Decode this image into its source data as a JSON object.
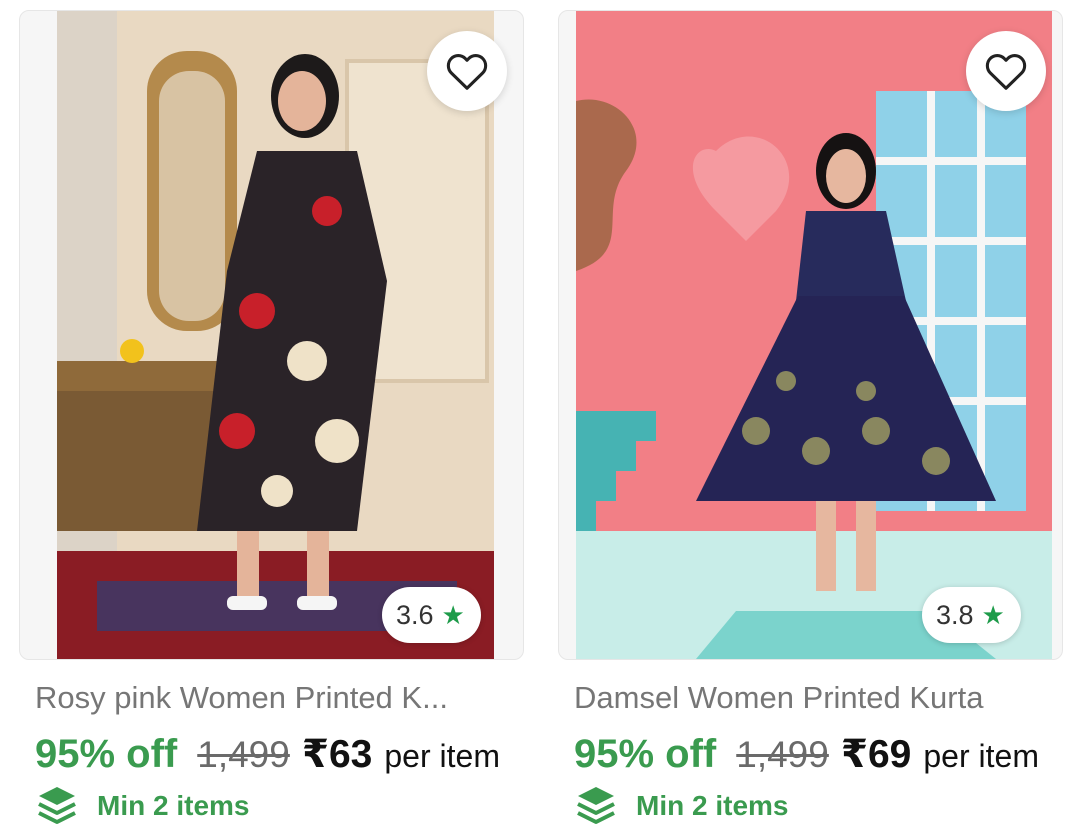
{
  "products": [
    {
      "title": "Rosy pink Women Printed K...",
      "rating": "3.6",
      "discount": "95% off",
      "mrp": "1,499",
      "price": "₹63",
      "unit": "per item",
      "min_order": "Min 2 items",
      "icons": {
        "wishlist": "heart-outline-icon",
        "rating": "star-icon",
        "min": "layers-icon"
      }
    },
    {
      "title": "Damsel Women Printed Kurta",
      "rating": "3.8",
      "discount": "95% off",
      "mrp": "1,499",
      "price": "₹69",
      "unit": "per item",
      "min_order": "Min 2 items",
      "icons": {
        "wishlist": "heart-outline-icon",
        "rating": "star-icon",
        "min": "layers-icon"
      }
    }
  ],
  "colors": {
    "accent_green": "#3a9b4f",
    "star_green": "#1e9b4a",
    "title_gray": "#767676"
  }
}
